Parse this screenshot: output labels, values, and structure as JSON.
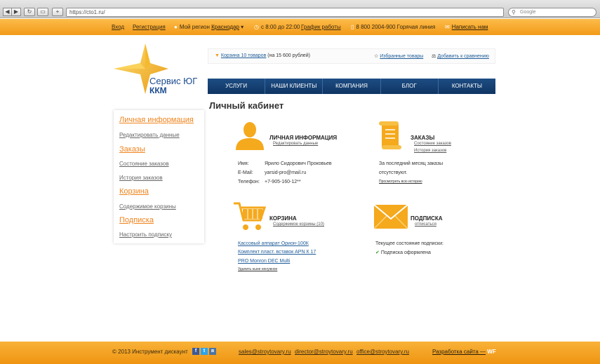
{
  "browser": {
    "url": "https://cto1.ru/",
    "search_placeholder": "Google"
  },
  "topbar": {
    "login": "Вход",
    "register": "Регистрация",
    "region_label": "Мой регион",
    "region_value": "Краснодар",
    "hours": "с 8:00 до 22:00",
    "schedule_link": "График работы",
    "hotline": "8 800 2004-900 Горячая линия",
    "write_us": "Написать нам"
  },
  "logo": {
    "line1": "Сервис ЮГ",
    "line2": "ККМ"
  },
  "cart_strip": {
    "cart_link": "Корзина 10 товаров",
    "cart_total": "(на 15 600 рублей)",
    "favorites": "Избранные товары",
    "compare": "Добавить к сравнению"
  },
  "main_nav": [
    "УСЛУГИ",
    "НАШИ КЛИЕНТЫ",
    "КОМПАНИЯ",
    "БЛОГ",
    "КОНТАКТЫ"
  ],
  "page_title": "Личный кабинет",
  "sidebar": {
    "personal_info": "Личная информация",
    "edit_data": "Редактировать данные",
    "orders": "Заказы",
    "order_status": "Состояние заказов",
    "order_history": "История заказов",
    "cart": "Корзина",
    "cart_contents": "Содержимое корзины",
    "subscription": "Подписка",
    "configure_subscription": "Настроить подписку"
  },
  "personal": {
    "title": "ЛИЧНАЯ ИНФОРМАЦИЯ",
    "edit_link": "Редактировать данные",
    "name_label": "Имя:",
    "name_value": "Ярило Сидорович Проковьев",
    "email_label": "E-Mail:",
    "email_value": "yarsid-pro@mail.ru",
    "phone_label": "Телефон:",
    "phone_value": "+7-905-160-12**"
  },
  "orders": {
    "title": "ЗАКАЗЫ",
    "status_link": "Состояние заказов",
    "history_link": "История заказов",
    "text_line1": "За последний месяц заказы",
    "text_line2": "отсутствуют.",
    "view_history": "Просмотреть всю историю"
  },
  "cart_block": {
    "title": "КОРЗИНА",
    "contents_link": "Содержимое корзины (10)",
    "items": [
      "Кассовый аппарат Орион-100К",
      "Комплект пласт. вставок APN К 17",
      "PRO Monron DEC Multi"
    ],
    "remove_link": "Удалить ныне ненужное"
  },
  "subscription_block": {
    "title": "ПОДПИСКА",
    "unsubscribe": "отписаться",
    "status_label": "Текущее состояние подписки:",
    "status_value": "Подписка оформлена"
  },
  "footer": {
    "copyright": "© 2013 Инструмент дискаунт",
    "social": [
      "f",
      "t",
      "в"
    ],
    "email1": "sales@stroytovary.ru",
    "email2": "director@stroytovary.ru",
    "email3": "office@stroytovary.ru",
    "dev_label": "Разработка сайта —",
    "dev_brand": "WF"
  },
  "colors": {
    "accent_orange": "#f29a18",
    "nav_blue": "#1d4d84",
    "brand_blue": "#1b4b8f"
  }
}
